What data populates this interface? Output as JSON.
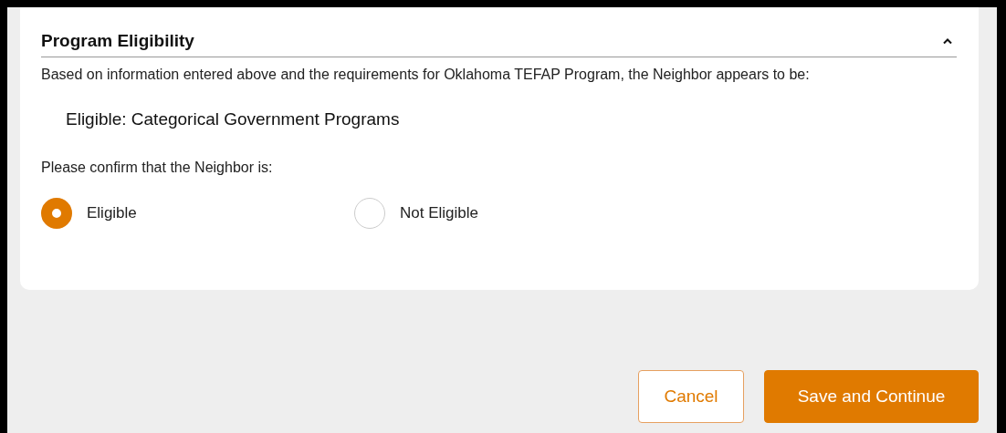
{
  "section": {
    "title": "Program Eligibility",
    "expanded": true,
    "description": "Based on information entered above and the requirements for Oklahoma TEFAP Program, the Neighbor appears to be:",
    "result": "Eligible: Categorical Government Programs",
    "prompt": "Please confirm that the Neighbor is:",
    "options": [
      {
        "label": "Eligible",
        "selected": true
      },
      {
        "label": "Not Eligible",
        "selected": false
      }
    ]
  },
  "buttons": [
    {
      "label": "Cancel",
      "kind": "secondary"
    },
    {
      "label": "Save and Continue",
      "kind": "primary"
    }
  ]
}
